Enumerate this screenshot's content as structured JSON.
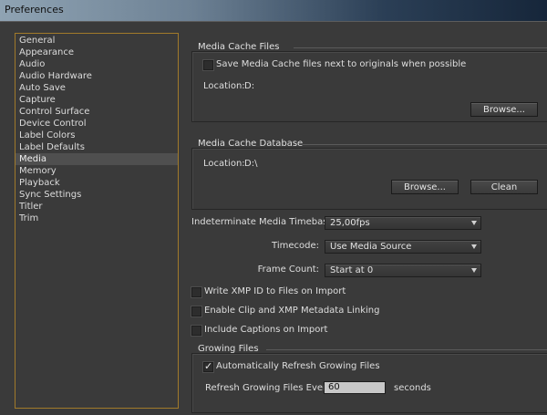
{
  "window": {
    "title": "Preferences"
  },
  "categories": {
    "items": [
      "General",
      "Appearance",
      "Audio",
      "Audio Hardware",
      "Auto Save",
      "Capture",
      "Control Surface",
      "Device Control",
      "Label Colors",
      "Label Defaults",
      "Media",
      "Memory",
      "Playback",
      "Sync Settings",
      "Titler",
      "Trim"
    ],
    "selected": "Media"
  },
  "media_cache_files": {
    "title": "Media Cache Files",
    "save_next_to_originals": {
      "label": "Save Media Cache files next to originals when possible",
      "checked": false
    },
    "location_label": "Location:",
    "location_value": "D:",
    "browse_label": "Browse..."
  },
  "media_cache_database": {
    "title": "Media Cache Database",
    "location_label": "Location:",
    "location_value": "D:\\",
    "browse_label": "Browse...",
    "clean_label": "Clean"
  },
  "settings": {
    "timebase": {
      "label": "Indeterminate Media Timebase:",
      "value": "25,00fps"
    },
    "timecode": {
      "label": "Timecode:",
      "value": "Use Media Source"
    },
    "frame_count": {
      "label": "Frame Count:",
      "value": "Start at 0"
    }
  },
  "options": {
    "write_xmp": {
      "label": "Write XMP ID to Files on Import",
      "checked": false
    },
    "clip_xmp_linking": {
      "label": "Enable Clip and XMP Metadata Linking",
      "checked": false
    },
    "include_captions": {
      "label": "Include Captions on Import",
      "checked": false
    }
  },
  "growing_files": {
    "title": "Growing Files",
    "auto_refresh": {
      "label": "Automatically Refresh Growing Files",
      "checked": true
    },
    "refresh_every_label": "Refresh Growing Files Every",
    "refresh_every_value": "60",
    "units_label": "seconds"
  }
}
